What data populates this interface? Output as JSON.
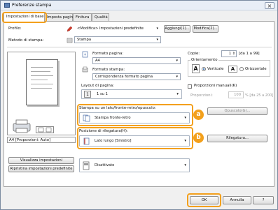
{
  "window": {
    "title": "Preferenze stampa",
    "close_glyph": "×"
  },
  "tabs": [
    {
      "label": "Impostazioni di base",
      "active": true
    },
    {
      "label": "Imposta pagina",
      "active": false
    },
    {
      "label": "Finitura",
      "active": false
    },
    {
      "label": "Qualità",
      "active": false
    }
  ],
  "profile": {
    "label": "Profilo:",
    "value": "<Modifica> Impostazioni predefinite",
    "add_label": "Aggiungi(1)...",
    "edit_label": "Modifica(2)..."
  },
  "method": {
    "label": "Metodo di stampa:",
    "value": "Stampa"
  },
  "page_size": {
    "label": "Formato pagina:",
    "value": "A4"
  },
  "output_size": {
    "label": "Formato stampa:",
    "value": "Corrispondenza formato pagina"
  },
  "copies": {
    "label": "Copie:",
    "value": "1",
    "range": "[da 1 a 99]"
  },
  "orientation": {
    "label": "Orientamento",
    "vertical_label": "Verticale",
    "horizontal_label": "Orizzontale",
    "vertical_glyph": "A",
    "horizontal_glyph": "A",
    "selected": "vertical"
  },
  "layout": {
    "label": "Layout di pagina:",
    "value": "1 su 1",
    "icon_text": "1"
  },
  "manual_scale": {
    "label": "Proporzioni manuali(K)",
    "scale_label": "Proporzioni:",
    "value": "100",
    "range": "% [da 25 a 200]"
  },
  "duplex": {
    "label": "Stampa su un lato/fronte-retro/opuscolo:",
    "value": "Stampa fronte-retro",
    "options_button": "Opuscolo(G)...",
    "badge": "a"
  },
  "binding": {
    "label": "Posizione di rilegatura(H):",
    "value": "Lato lungo [Sinistro]",
    "button": "Rilegatura...",
    "badge": "b"
  },
  "color_mode": {
    "value": "Disattivato"
  },
  "preview": {
    "caption": "A4 [Proporzioni: Auto]"
  },
  "left_buttons": {
    "view_settings": "Visualizza impostazioni",
    "restore_defaults": "Ripristina impostazioni predefinite"
  },
  "footer": {
    "ok": "OK",
    "cancel": "Annulla",
    "help": "?"
  },
  "colors": {
    "highlight": "#f3a01c",
    "selection_blue": "#1a5fb4"
  }
}
